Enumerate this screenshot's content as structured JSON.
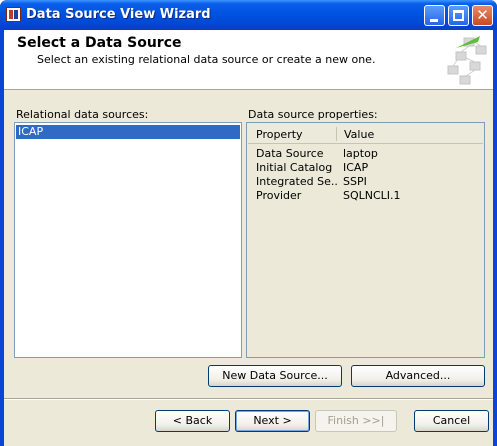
{
  "window": {
    "title": "Data Source View Wizard"
  },
  "header": {
    "title": "Select a Data Source",
    "subtitle": "Select an existing relational data source or create a new one."
  },
  "relational": {
    "label": "Relational data sources:",
    "items": [
      {
        "label": "ICAP",
        "selected": true
      }
    ]
  },
  "properties": {
    "label": "Data source properties:",
    "columns": [
      "Property",
      "Value"
    ],
    "rows": [
      {
        "property": "Data Source",
        "value": "laptop"
      },
      {
        "property": "Initial Catalog",
        "value": "ICAP"
      },
      {
        "property": "Integrated Se...",
        "value": "SSPI"
      },
      {
        "property": "Provider",
        "value": "SQLNCLI.1"
      }
    ]
  },
  "buttons": {
    "new_data_source": "New Data Source...",
    "advanced": "Advanced...",
    "back": "< Back",
    "next": "Next >",
    "finish": "Finish >>|",
    "cancel": "Cancel"
  },
  "colors": {
    "titlebar": "#0054e3",
    "selection": "#316ac5",
    "dialog_bg": "#ece9d8"
  },
  "icons": {
    "app": "wizard-app-icon",
    "minimize": "minimize-icon",
    "maximize": "maximize-icon",
    "close": "close-icon",
    "header_graphic": "cube-network-icon"
  }
}
